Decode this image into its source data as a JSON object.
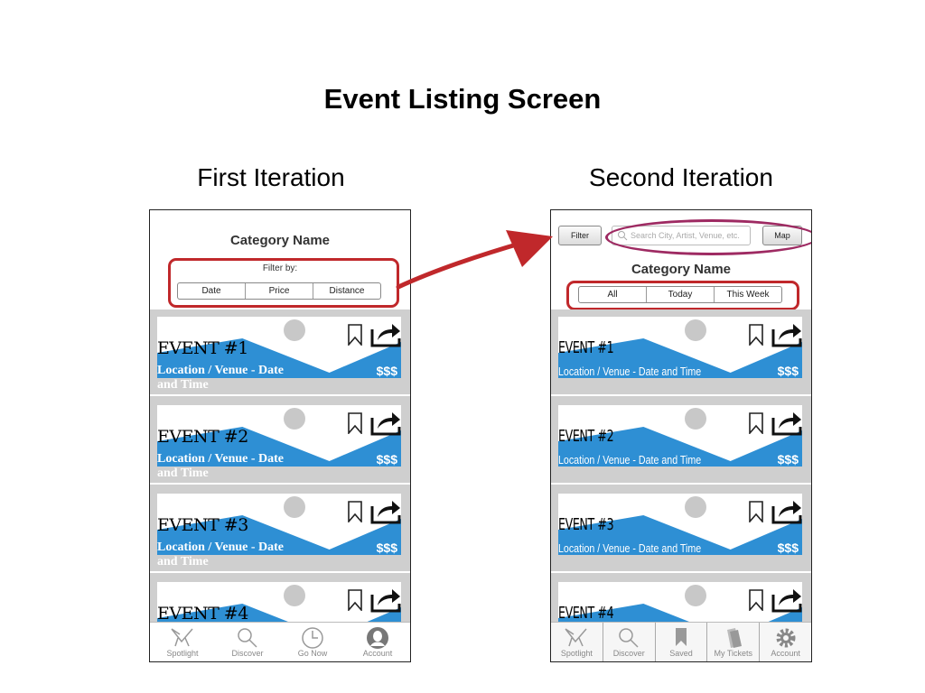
{
  "slide": {
    "title": "Event Listing Screen",
    "left_heading": "First Iteration",
    "right_heading": "Second Iteration"
  },
  "first_iteration": {
    "category_name": "Category Name",
    "filter_label": "Filter by:",
    "filter_options": [
      "Date",
      "Price",
      "Distance"
    ],
    "events": [
      {
        "title": "EVENT #1",
        "location": "Location / Venue - Date",
        "location_wrap": "and Time",
        "price": "$$$"
      },
      {
        "title": "EVENT #2",
        "location": "Location / Venue - Date",
        "location_wrap": "and Time",
        "price": "$$$"
      },
      {
        "title": "EVENT #3",
        "location": "Location / Venue - Date",
        "location_wrap": "and Time",
        "price": "$$$"
      },
      {
        "title": "EVENT #4"
      }
    ],
    "tabs": [
      {
        "label": "Spotlight",
        "icon": "spotlight-icon"
      },
      {
        "label": "Discover",
        "icon": "search-icon"
      },
      {
        "label": "Go Now",
        "icon": "clock-icon"
      },
      {
        "label": "Account",
        "icon": "person-icon"
      }
    ]
  },
  "second_iteration": {
    "filter_button": "Filter",
    "search_placeholder": "Search City, Artist, Venue, etc.",
    "map_button": "Map",
    "category_name": "Category Name",
    "time_options": [
      "All",
      "Today",
      "This Week"
    ],
    "events": [
      {
        "title": "EVENT #1",
        "location": "Location / Venue - Date and Time",
        "price": "$$$"
      },
      {
        "title": "EVENT #2",
        "location": "Location / Venue - Date and Time",
        "price": "$$$"
      },
      {
        "title": "EVENT #3",
        "location": "Location / Venue - Date and Time",
        "price": "$$$"
      },
      {
        "title": "EVENT #4"
      }
    ],
    "tabs": [
      {
        "label": "Spotlight",
        "icon": "spotlight-icon"
      },
      {
        "label": "Discover",
        "icon": "search-icon"
      },
      {
        "label": "Saved",
        "icon": "bookmark-icon"
      },
      {
        "label": "My Tickets",
        "icon": "tickets-icon"
      },
      {
        "label": "Account",
        "icon": "gear-icon"
      }
    ]
  },
  "colors": {
    "highlight_red": "#c0282b",
    "highlight_purple": "#9e2a62",
    "image_blue": "#2e8fd4",
    "list_gray": "#cfcfcf"
  }
}
